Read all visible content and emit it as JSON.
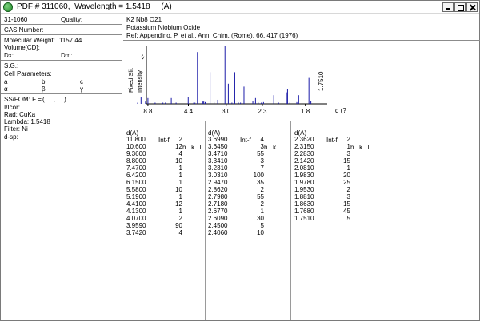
{
  "window": {
    "title": "PDF # 311060,  Wavelength = 1.5418     (A)"
  },
  "left": {
    "pdf_number": "31-1060",
    "quality_label": "Quality:",
    "cas_label": "CAS Number:",
    "mol_weight_label": "Molecular Weight:",
    "mol_weight_value": "1157.44",
    "volume_label": "Volume[CD]:",
    "dx_label": "Dx:",
    "dm_label": "Dm:",
    "sg_label": "S.G.:",
    "cell_params_label": "Cell Parameters:",
    "cell_a": "a",
    "cell_b": "b",
    "cell_c": "c",
    "cell_alpha": "α",
    "cell_beta": "β",
    "cell_gamma": "γ",
    "ssfom_label": "SS/FOM: F =",
    "ssfom_value": "(     ,     )",
    "icor_label": "I/Icor:",
    "rad_label": "Rad: CuKa",
    "lambda_label": "Lambda: 1.5418",
    "filter_label": "Filter: Ni",
    "dsp_label": "d-sp:"
  },
  "header": {
    "formula": "K2 Nb8 O21",
    "name": "Potassium Niobium Oxide",
    "reference": "Ref: Appendino, P. et al., Ann. Chim. (Rome), 66, 417 (1976)"
  },
  "chart_data": {
    "type": "bar",
    "ylabel_1": "Fixed Slit",
    "ylabel_2": "Intensity",
    "ylabel_arrow": "->",
    "xlabel": "d (?",
    "wavelength_annotation": "1.7510",
    "x_ticks": [
      "8.8",
      "4.4",
      "3.0",
      "2.3",
      "1.8"
    ],
    "peaks": [
      {
        "d": 11.8,
        "i": 2
      },
      {
        "d": 10.6,
        "i": 12
      },
      {
        "d": 9.36,
        "i": 4
      },
      {
        "d": 8.8,
        "i": 10
      },
      {
        "d": 7.47,
        "i": 1
      },
      {
        "d": 6.42,
        "i": 1
      },
      {
        "d": 6.15,
        "i": 1
      },
      {
        "d": 5.58,
        "i": 10
      },
      {
        "d": 5.19,
        "i": 1
      },
      {
        "d": 4.41,
        "i": 12
      },
      {
        "d": 4.13,
        "i": 1
      },
      {
        "d": 4.07,
        "i": 2
      },
      {
        "d": 3.959,
        "i": 90
      },
      {
        "d": 3.742,
        "i": 4
      },
      {
        "d": 3.699,
        "i": 4
      },
      {
        "d": 3.645,
        "i": 3
      },
      {
        "d": 3.471,
        "i": 55
      },
      {
        "d": 3.341,
        "i": 3
      },
      {
        "d": 3.231,
        "i": 7
      },
      {
        "d": 3.031,
        "i": 100
      },
      {
        "d": 2.947,
        "i": 35
      },
      {
        "d": 2.862,
        "i": 2
      },
      {
        "d": 2.798,
        "i": 55
      },
      {
        "d": 2.718,
        "i": 2
      },
      {
        "d": 2.677,
        "i": 1
      },
      {
        "d": 2.609,
        "i": 30
      },
      {
        "d": 2.45,
        "i": 5
      },
      {
        "d": 2.406,
        "i": 10
      },
      {
        "d": 2.362,
        "i": 2
      },
      {
        "d": 2.315,
        "i": 1
      },
      {
        "d": 2.283,
        "i": 3
      },
      {
        "d": 2.142,
        "i": 15
      },
      {
        "d": 2.081,
        "i": 1
      },
      {
        "d": 1.983,
        "i": 20
      },
      {
        "d": 1.978,
        "i": 25
      },
      {
        "d": 1.953,
        "i": 2
      },
      {
        "d": 1.881,
        "i": 3
      },
      {
        "d": 1.863,
        "i": 15
      },
      {
        "d": 1.768,
        "i": 45
      },
      {
        "d": 1.751,
        "i": 5
      }
    ]
  },
  "table": {
    "header_d": "d(A)",
    "header_int": "Int-f",
    "header_hkl": "h   k   l",
    "columns": [
      [
        [
          "11.800",
          "2"
        ],
        [
          "10.600",
          "12"
        ],
        [
          "9.3600",
          "4"
        ],
        [
          "8.8000",
          "10"
        ],
        [
          "7.4700",
          "1"
        ],
        [
          "6.4200",
          "1"
        ],
        [
          "6.1500",
          "1"
        ],
        [
          "5.5800",
          "10"
        ],
        [
          "5.1900",
          "1"
        ],
        [
          "4.4100",
          "12"
        ],
        [
          "4.1300",
          "1"
        ],
        [
          "4.0700",
          "2"
        ],
        [
          "3.9590",
          "90"
        ],
        [
          "3.7420",
          "4"
        ]
      ],
      [
        [
          "3.6990",
          "4"
        ],
        [
          "3.6450",
          "3"
        ],
        [
          "3.4710",
          "55"
        ],
        [
          "3.3410",
          "3"
        ],
        [
          "3.2310",
          "7"
        ],
        [
          "3.0310",
          "100"
        ],
        [
          "2.9470",
          "35"
        ],
        [
          "2.8620",
          "2"
        ],
        [
          "2.7980",
          "55"
        ],
        [
          "2.7180",
          "2"
        ],
        [
          "2.6770",
          "1"
        ],
        [
          "2.6090",
          "30"
        ],
        [
          "2.4500",
          "5"
        ],
        [
          "2.4060",
          "10"
        ]
      ],
      [
        [
          "2.3620",
          "2"
        ],
        [
          "2.3150",
          "1"
        ],
        [
          "2.2830",
          "3"
        ],
        [
          "2.1420",
          "15"
        ],
        [
          "2.0810",
          "1"
        ],
        [
          "1.9830",
          "20"
        ],
        [
          "1.9780",
          "25"
        ],
        [
          "1.9530",
          "2"
        ],
        [
          "1.8810",
          "3"
        ],
        [
          "1.8630",
          "15"
        ],
        [
          "1.7680",
          "45"
        ],
        [
          "1.7510",
          "5"
        ]
      ]
    ]
  }
}
